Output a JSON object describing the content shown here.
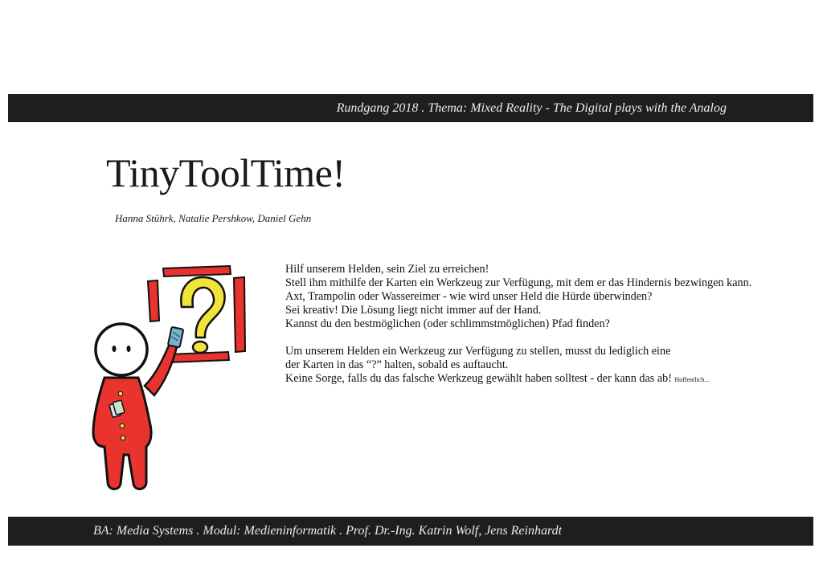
{
  "header": {
    "banner_text": "Rundgang 2018 . Thema: Mixed Reality - The Digital plays with the Analog"
  },
  "title": "TinyToolTime!",
  "authors": "Hanna Stührk, Natalie Pershkow, Daniel Gehn",
  "description": {
    "lines": [
      "Hilf unserem Helden, sein Ziel zu erreichen!",
      "Stell ihm mithilfe der Karten ein Werkzeug zur Verfügung, mit dem er das Hindernis bezwingen kann.",
      "Axt, Trampolin oder Wassereimer - wie wird unser Held die Hürde überwinden?",
      "Sei kreativ! Die Lösung liegt nicht immer auf der Hand.",
      "Kannst du den bestmöglichen (oder schlimmstmöglichen) Pfad finden?"
    ],
    "instructions": [
      "Um unserem Helden ein Werkzeug zur Verfügung zu stellen, musst du lediglich eine",
      "der Karten in das “?” halten, sobald es auftaucht."
    ],
    "closing": "Keine Sorge, falls du das falsche Werkzeug gewählt haben solltest - der kann das ab! ",
    "closing_small": "Hoffentlich..."
  },
  "illustration": {
    "icon": "hero-question-mark-icon",
    "colors": {
      "red": "#e8332f",
      "yellow": "#f1e33a",
      "outline": "#111111"
    }
  },
  "footer": {
    "banner_text": "BA: Media Systems . Modul: Medieninformatik . Prof. Dr.-Ing. Katrin Wolf, Jens Reinhardt"
  }
}
